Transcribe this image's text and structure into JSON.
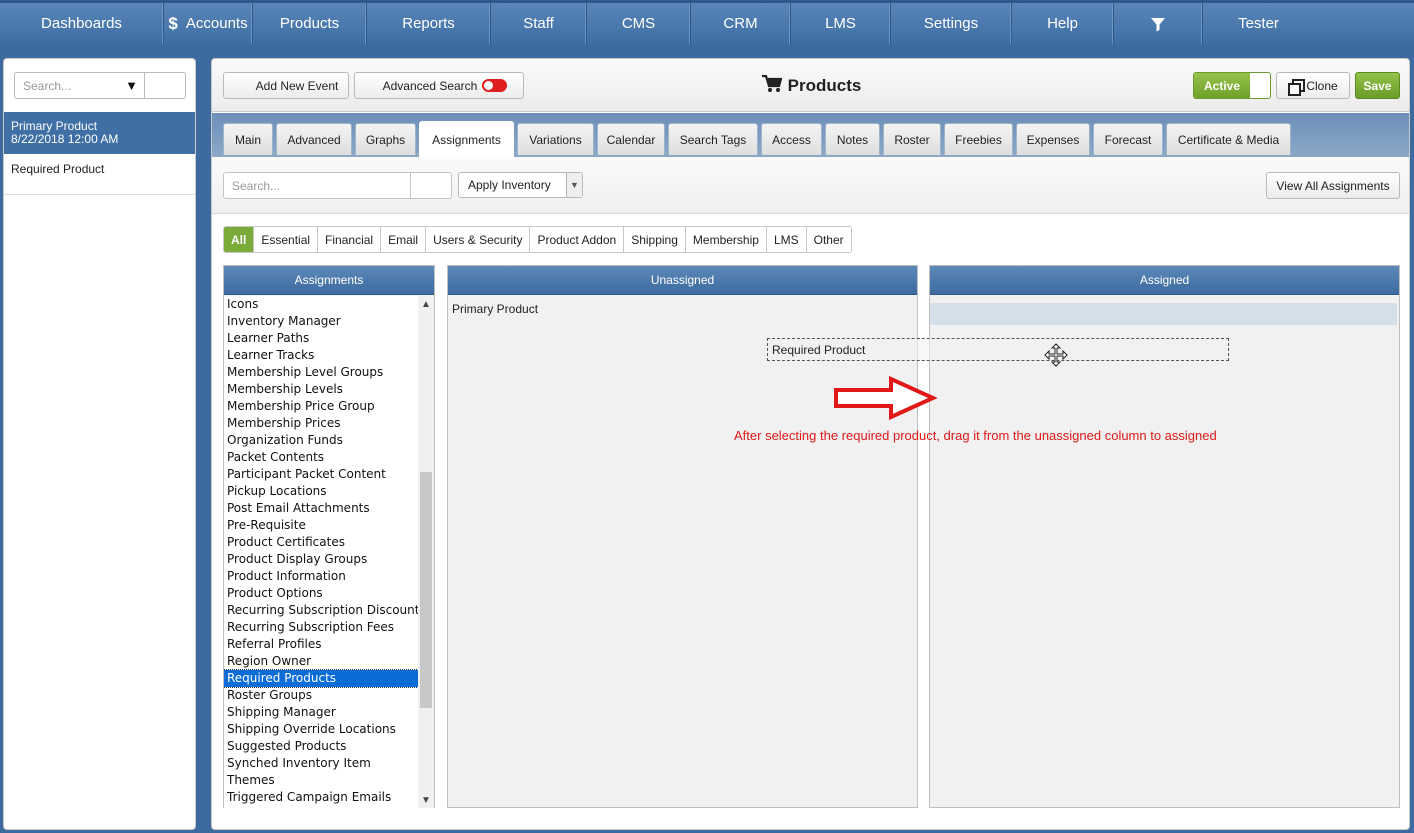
{
  "topnav": {
    "items": [
      "Dashboards",
      "Accounts",
      "Products",
      "Reports",
      "Staff",
      "CMS",
      "CRM",
      "LMS",
      "Settings",
      "Help"
    ],
    "user": "Tester"
  },
  "sidebar": {
    "search_placeholder": "Search...",
    "selected_title": "Primary Product",
    "selected_date": "8/22/2018 12:00 AM",
    "item": "Required Product"
  },
  "header": {
    "add_event": "Add New Event",
    "advanced_search": "Advanced Search",
    "title": "Products",
    "active": "Active",
    "clone": "Clone",
    "save": "Save"
  },
  "tabs": [
    "Main",
    "Advanced",
    "Graphs",
    "Assignments",
    "Variations",
    "Calendar",
    "Search Tags",
    "Access",
    "Notes",
    "Roster",
    "Freebies",
    "Expenses",
    "Forecast",
    "Certificate & Media"
  ],
  "active_tab": "Assignments",
  "toolbar": {
    "search_placeholder": "Search...",
    "select_value": "Apply Inventory",
    "view_all": "View All Assignments"
  },
  "filters": [
    "All",
    "Essential",
    "Financial",
    "Email",
    "Users & Security",
    "Product Addon",
    "Shipping",
    "Membership",
    "LMS",
    "Other"
  ],
  "columns": {
    "assignments": "Assignments",
    "unassigned": "Unassigned",
    "assigned": "Assigned"
  },
  "assignment_list": [
    "Icons",
    "Inventory Manager",
    "Learner Paths",
    "Learner Tracks",
    "Membership Level Groups",
    "Membership Levels",
    "Membership Price Group",
    "Membership Prices",
    "Organization Funds",
    "Packet Contents",
    "Participant Packet Content",
    "Pickup Locations",
    "Post Email Attachments",
    "Pre-Requisite",
    "Product Certificates",
    "Product Display Groups",
    "Product Information",
    "Product Options",
    "Recurring Subscription Discounts",
    "Recurring Subscription Fees",
    "Referral Profiles",
    "Region Owner",
    "Required Products",
    "Roster Groups",
    "Shipping Manager",
    "Shipping Override Locations",
    "Suggested Products",
    "Synched Inventory Item",
    "Themes",
    "Triggered Campaign Emails"
  ],
  "selected_assignment": "Required Products",
  "unassigned_items": [
    "Primary Product"
  ],
  "dragging_item": "Required Product",
  "annotation": "After selecting the required product, drag it from the unassigned column to assigned",
  "colors": {
    "nav": "#3e6ea3",
    "accent_green": "#7aab39",
    "annotation_red": "#e01818",
    "selection_blue": "#0a6cd6"
  }
}
